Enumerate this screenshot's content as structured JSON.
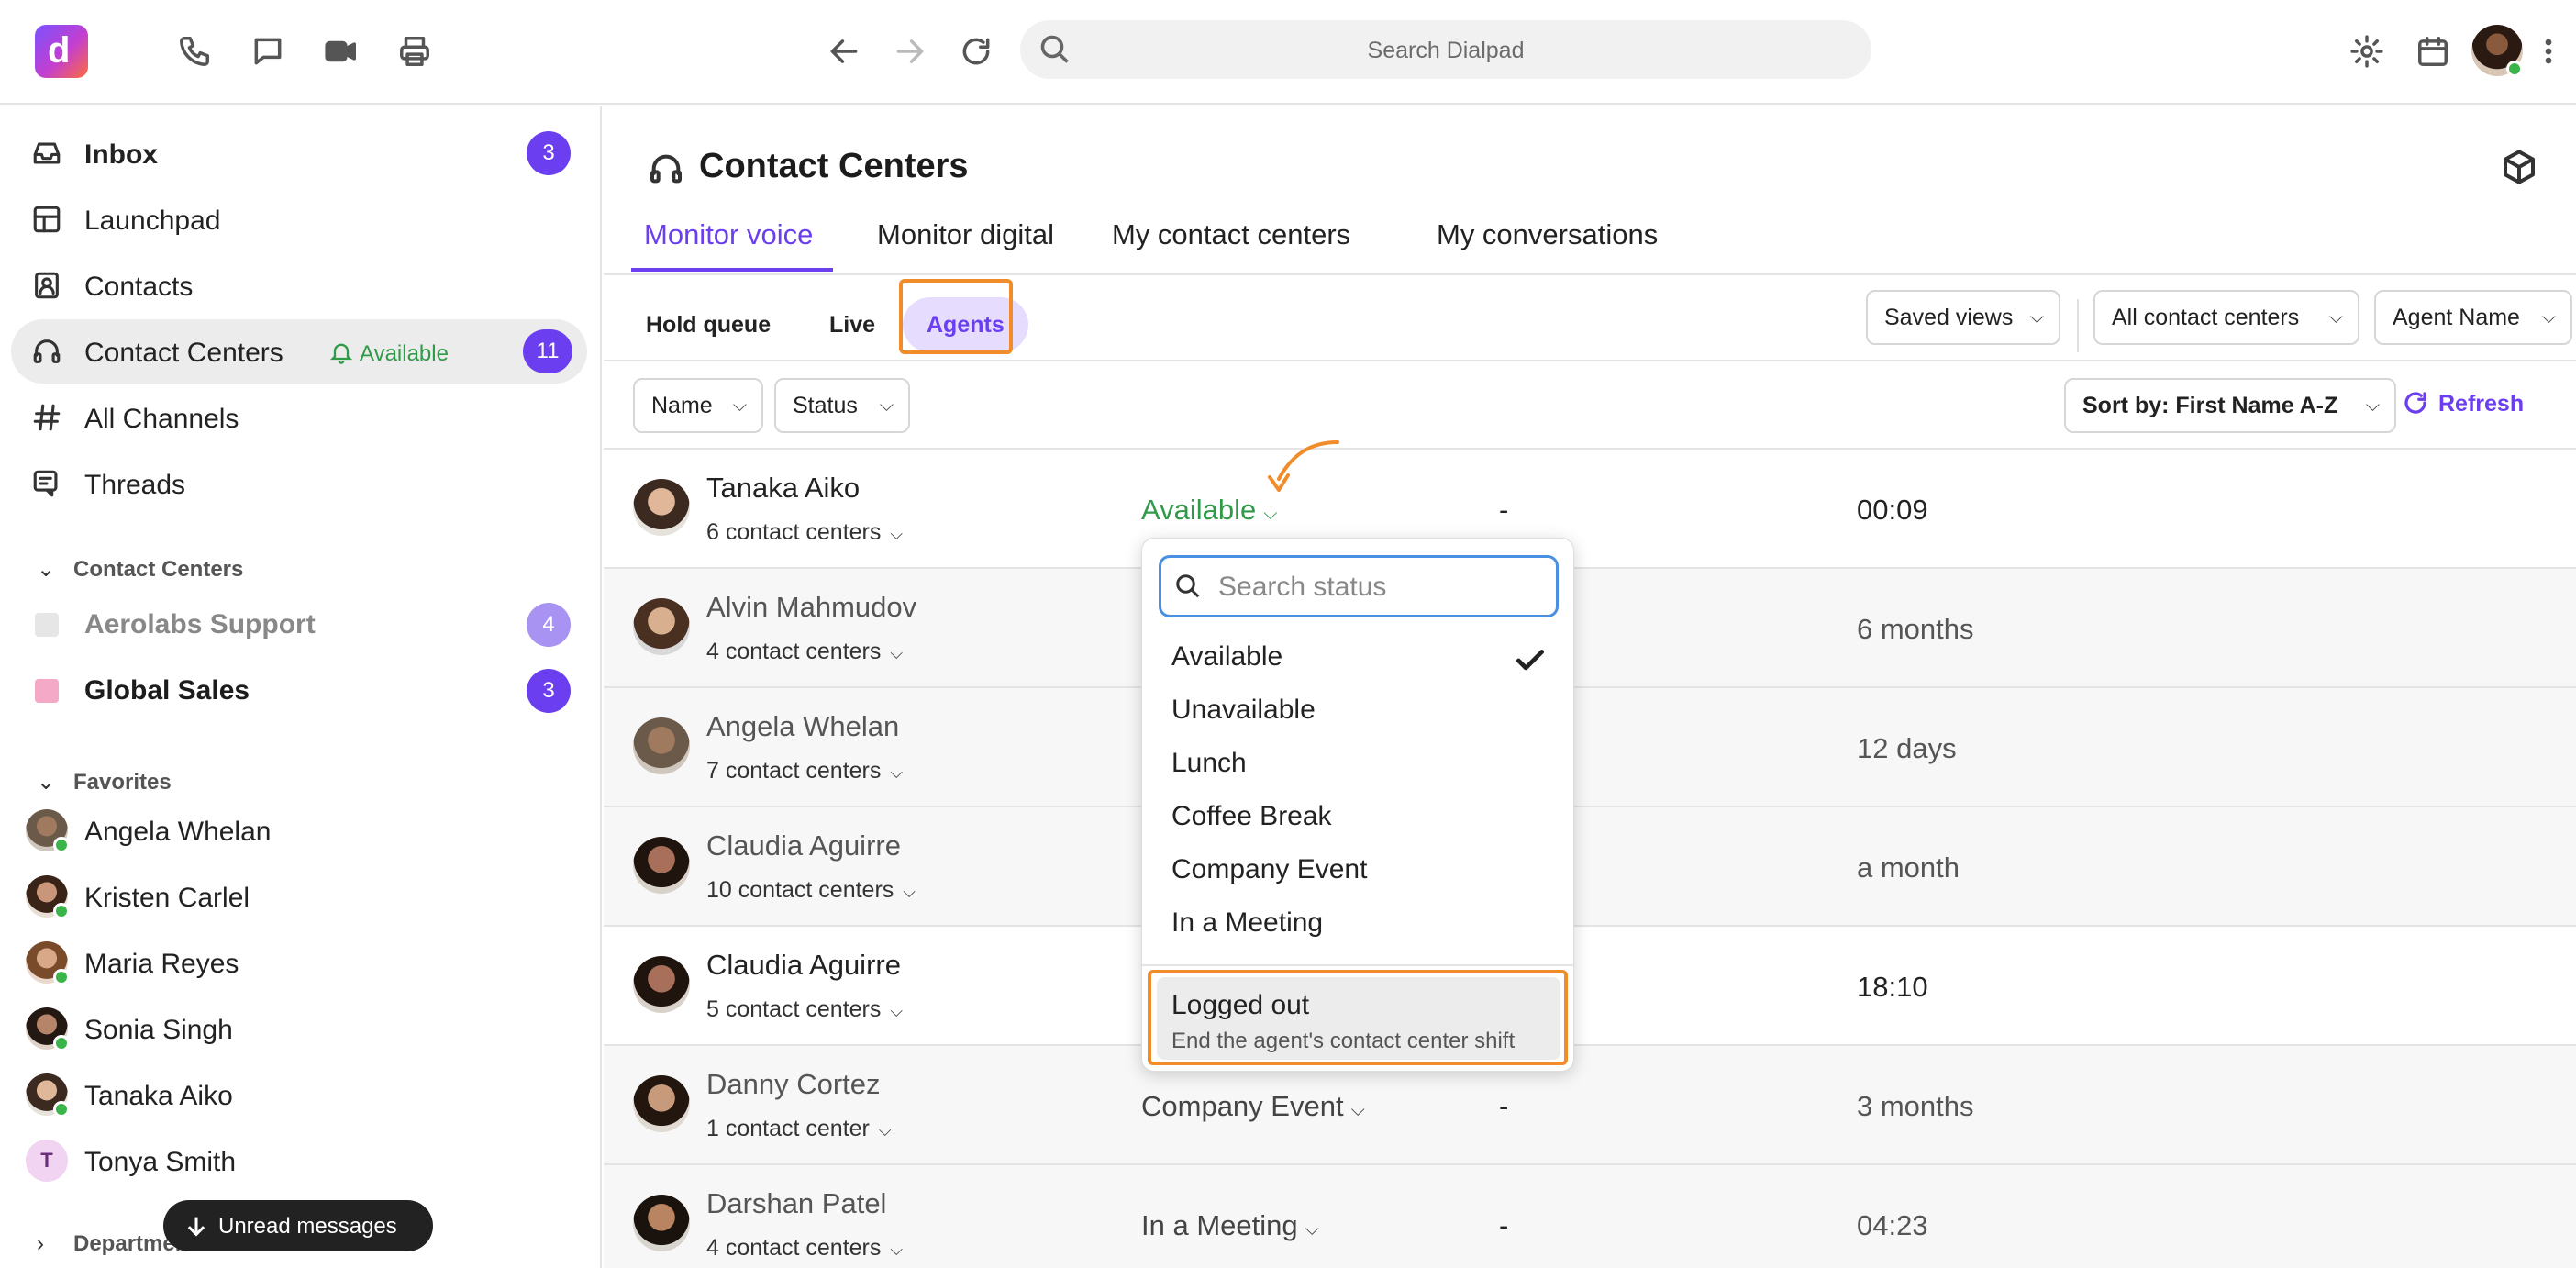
{
  "topbar": {
    "logo_letter": "d",
    "search_placeholder": "Search Dialpad",
    "icons": [
      "phone-icon",
      "chat-icon",
      "video-icon",
      "print-icon",
      "back-icon",
      "forward-icon",
      "reload-icon",
      "settings-icon",
      "calendar-icon",
      "more-icon"
    ]
  },
  "sidebar": {
    "items": [
      {
        "label": "Inbox",
        "badge": "3",
        "icon": "inbox-icon"
      },
      {
        "label": "Launchpad",
        "icon": "launchpad-icon"
      },
      {
        "label": "Contacts",
        "icon": "contacts-icon"
      },
      {
        "label": "Contact Centers",
        "badge": "11",
        "status": "Available",
        "icon": "headset-icon"
      },
      {
        "label": "All Channels",
        "icon": "hash-icon"
      },
      {
        "label": "Threads",
        "icon": "threads-icon"
      }
    ],
    "contact_centers_header": "Contact Centers",
    "contact_centers": [
      {
        "label": "Aerolabs Support",
        "badge": "4",
        "color": "#e6e6e6"
      },
      {
        "label": "Global Sales",
        "badge": "3",
        "color": "#f4a9c6"
      }
    ],
    "favorites_header": "Favorites",
    "favorites": [
      {
        "name": "Angela Whelan"
      },
      {
        "name": "Kristen Carlel"
      },
      {
        "name": "Maria Reyes"
      },
      {
        "name": "Sonia Singh"
      },
      {
        "name": "Tanaka Aiko"
      },
      {
        "name": "Tonya Smith",
        "initial": "T"
      }
    ],
    "unread_label": "Unread messages",
    "departments_header": "Departments"
  },
  "main": {
    "title": "Contact Centers",
    "tabs": [
      "Monitor voice",
      "Monitor digital",
      "My contact centers",
      "My conversations"
    ],
    "subtabs": [
      "Hold queue",
      "Live",
      "Agents"
    ],
    "saved_views": "Saved views",
    "all_centers": "All contact centers",
    "agent_name_filter": "Agent Name",
    "filter_name": "Name",
    "filter_status": "Status",
    "sort": "Sort by: First Name A-Z",
    "refresh": "Refresh",
    "agents": [
      {
        "name": "Tanaka Aiko",
        "centers": "6 contact centers",
        "status": "Available",
        "dash": "-",
        "time": "00:09"
      },
      {
        "name": "Alvin Mahmudov",
        "centers": "4 contact centers",
        "status": "",
        "dash": "",
        "time": "6 months"
      },
      {
        "name": "Angela Whelan",
        "centers": "7 contact centers",
        "status": "",
        "dash": "",
        "time": "12 days"
      },
      {
        "name": "Claudia Aguirre",
        "centers": "10 contact centers",
        "status": "",
        "dash": "",
        "time": "a month"
      },
      {
        "name": "Claudia Aguirre",
        "centers": "5 contact centers",
        "status": "",
        "dash": "",
        "time": "18:10"
      },
      {
        "name": "Danny Cortez",
        "centers": "1 contact center",
        "status": "Company Event",
        "dash": "-",
        "time": "3 months"
      },
      {
        "name": "Darshan Patel",
        "centers": "4 contact centers",
        "status": "In a Meeting",
        "dash": "-",
        "time": "04:23"
      }
    ]
  },
  "status_dropdown": {
    "search_placeholder": "Search status",
    "options": [
      "Available",
      "Unavailable",
      "Lunch",
      "Coffee Break",
      "Company Event",
      "In a Meeting"
    ],
    "selected": "Available",
    "logout_title": "Logged out",
    "logout_sub": "End the agent's contact center shift"
  },
  "colors": {
    "accent": "#6b3ff0",
    "available": "#2f9a48",
    "highlight": "#f08c2a"
  }
}
